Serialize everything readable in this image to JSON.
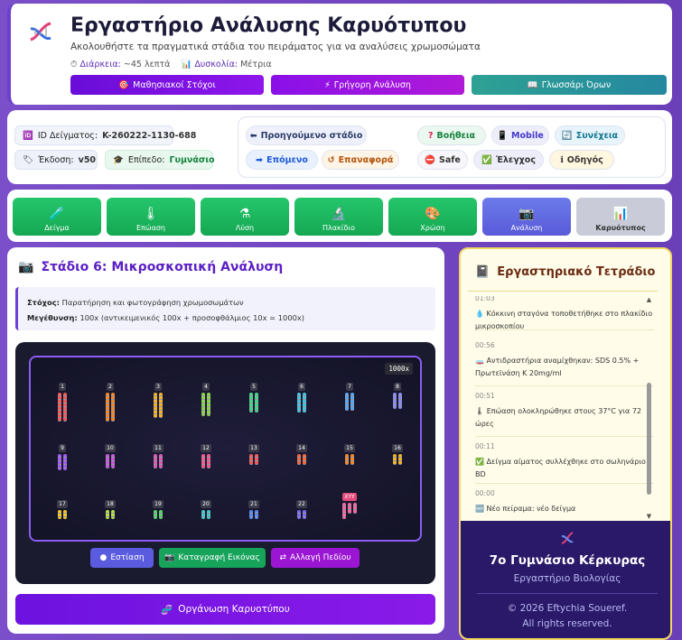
{
  "header": {
    "title": "Εργαστήριο Ανάλυσης Καρυότυπου",
    "subtitle": "Ακολουθήστε τα πραγματικά στάδια του πειράματος για να αναλύσεις χρωμοσώματα",
    "duration_label": "Διάρκεια:",
    "duration_value": "~45 λεπτά",
    "difficulty_label": "Δυσκολία:",
    "difficulty_value": "Μέτρια",
    "buttons": [
      "Μαθησιακοί Στόχοι",
      "Γρήγορη Ανάλυση",
      "Γλωσσάρι Όρων"
    ]
  },
  "controls": {
    "sample_id_label": "ID Δείγματος:",
    "sample_id_value": "K-260222-1130-688",
    "version_label": "Έκδοση:",
    "version_value": "v50",
    "level_label": "Επίπεδο:",
    "level_value": "Γυμνάσιο",
    "nav": {
      "prev": "Προηγούμενο στάδιο",
      "next": "Επόμενο",
      "reset": "Επαναφορά",
      "help": "Βοήθεια",
      "mobile": "Mobile",
      "continue": "Συνέχεια",
      "safe": "Safe",
      "check": "Έλεγχος",
      "guide": "Οδηγός"
    }
  },
  "stages": [
    {
      "label": "Δείγμα",
      "icon": "🧪",
      "state": "done"
    },
    {
      "label": "Επώαση",
      "icon": "🌡",
      "state": "done"
    },
    {
      "label": "Λύση",
      "icon": "⚗",
      "state": "done"
    },
    {
      "label": "Πλακίδιο",
      "icon": "🔬",
      "state": "done"
    },
    {
      "label": "Χρώση",
      "icon": "🎨",
      "state": "done"
    },
    {
      "label": "Ανάλυση",
      "icon": "📷",
      "state": "active"
    },
    {
      "label": "Καρυότυπος",
      "icon": "📊",
      "state": "todo"
    }
  ],
  "main": {
    "stage_title": "Στάδιο 6: Μικροσκοπική Ανάλυση",
    "goal_label": "Στόχος:",
    "goal_text": "Παρατήρηση και φωτογράφηση χρωμοσωμάτων",
    "mag_label": "Μεγέθυνση:",
    "mag_text": "100x (αντικειμενικός 100x + προσοφθάλμιος 10x = 1000x)",
    "mag_badge": "1000x",
    "chromosome_labels": [
      "1",
      "2",
      "3",
      "4",
      "5",
      "6",
      "7",
      "8",
      "9",
      "10",
      "11",
      "12",
      "13",
      "14",
      "15",
      "16",
      "17",
      "18",
      "19",
      "20",
      "21",
      "22",
      "XYY"
    ],
    "buttons": [
      "Εστίαση",
      "Καταγραφή Εικόνας",
      "Αλλαγή Πεδίου"
    ],
    "organize_button": "Οργάνωση Καρυοτύπου"
  },
  "notebook": {
    "title": "Εργαστηριακό Τετράδιο",
    "entries": [
      {
        "time": "01:03",
        "icon": "💧",
        "text": "Κόκκινη σταγόνα τοποθετήθηκε στο πλακίδιο μικροσκοπίου"
      },
      {
        "time": "00:56",
        "icon": "🧫",
        "text": "Αντιδραστήρια αναμίχθηκαν: SDS 0.5% + Πρωτεϊνάση Κ 20mg/ml"
      },
      {
        "time": "00:51",
        "icon": "🌡",
        "text": "Επώαση ολοκληρώθηκε στους 37°C για 72 ώρες"
      },
      {
        "time": "00:11",
        "icon": "✅",
        "text": "Δείγμα αίματος συλλέχθηκε στο σωληνάριο BD"
      },
      {
        "time": "00:00",
        "icon": "🆕",
        "text": "Νέο πείραμα: νέο δείγμα"
      }
    ]
  },
  "footer": {
    "school": "7ο Γυμνάσιο Κέρκυρας",
    "lab": "Εργαστήριο Βιολογίας",
    "copyright": "© 2026 Eftychia Soueref.",
    "rights": "All rights reserved."
  }
}
